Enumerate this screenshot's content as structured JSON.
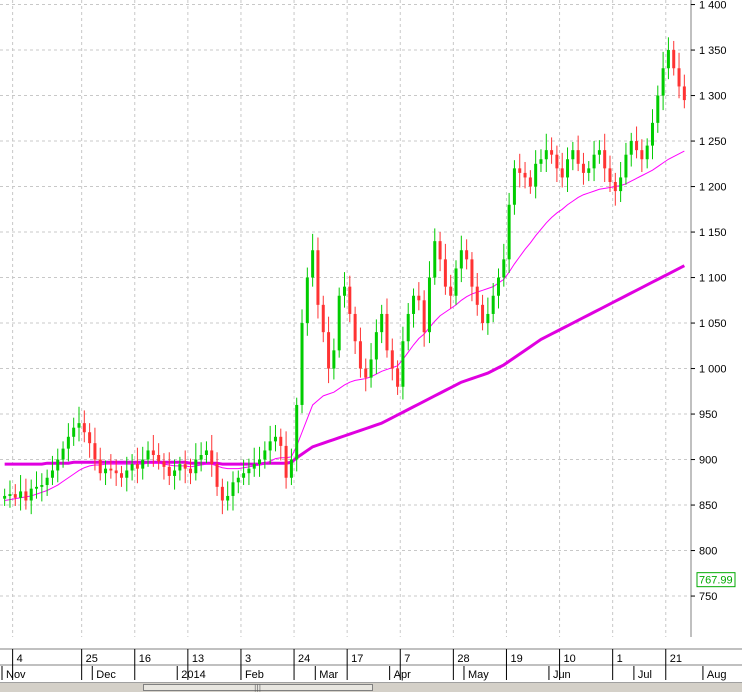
{
  "chart_data": {
    "type": "candlestick",
    "colors": {
      "up": "#00cc00",
      "down": "#ff3333",
      "ma_fast": "#ff00ff",
      "ma_slow": "#e000e0",
      "price_tag": "#00aa00"
    },
    "y_axis": {
      "ticks": [
        "1 400",
        "1 350",
        "1 300",
        "1 250",
        "1 200",
        "1 150",
        "1 100",
        "1 050",
        "1 000",
        "950",
        "900",
        "850",
        "800",
        "750"
      ],
      "tick_values": [
        1400,
        1350,
        1300,
        1250,
        1200,
        1150,
        1100,
        1050,
        1000,
        950,
        900,
        850,
        800,
        750
      ],
      "ylim": [
        705,
        1405
      ],
      "position": "right"
    },
    "x_axis": {
      "day_labels": [
        "4",
        "25",
        "16",
        "13",
        "3",
        "24",
        "17",
        "7",
        "28",
        "19",
        "10",
        "1",
        "21"
      ],
      "day_positions": [
        2,
        15,
        25,
        35,
        45,
        55,
        65,
        75,
        85,
        95,
        105,
        115,
        125
      ],
      "month_labels": [
        "Nov",
        "Dec",
        "2014",
        "Feb",
        "Mar",
        "Apr",
        "May",
        "Jun",
        "Jul",
        "Aug"
      ],
      "month_positions": [
        0,
        17,
        33,
        45,
        59,
        73,
        87,
        103,
        119,
        132
      ]
    },
    "last_price_tag": "767.99",
    "last_price_value": 767.99,
    "candles_close": [
      860,
      862,
      858,
      865,
      855,
      868,
      870,
      872,
      880,
      888,
      900,
      912,
      925,
      935,
      940,
      930,
      918,
      900,
      885,
      890,
      888,
      885,
      880,
      888,
      895,
      890,
      900,
      910,
      905,
      898,
      892,
      882,
      888,
      895,
      890,
      885,
      900,
      905,
      910,
      895,
      870,
      855,
      860,
      875,
      880,
      885,
      890,
      895,
      900,
      910,
      920,
      925,
      915,
      880,
      900,
      960,
      1050,
      1100,
      1130,
      1070,
      1040,
      1000,
      1020,
      1080,
      1090,
      1060,
      1030,
      1000,
      990,
      1010,
      1040,
      1060,
      1020,
      1000,
      980,
      1030,
      1060,
      1080,
      1075,
      1040,
      1100,
      1140,
      1120,
      1090,
      1080,
      1110,
      1130,
      1120,
      1090,
      1070,
      1050,
      1060,
      1080,
      1100,
      1120,
      1180,
      1220,
      1215,
      1210,
      1200,
      1225,
      1230,
      1240,
      1235,
      1220,
      1210,
      1230,
      1240,
      1225,
      1215,
      1220,
      1235,
      1240,
      1220,
      1205,
      1195,
      1210,
      1235,
      1250,
      1240,
      1230,
      1245,
      1270,
      1300,
      1330,
      1350,
      1330,
      1310,
      1295
    ],
    "ma_fast": [
      855,
      856,
      857,
      858,
      859,
      860,
      862,
      864,
      866,
      869,
      872,
      876,
      880,
      884,
      888,
      891,
      893,
      894,
      894,
      895,
      895,
      895,
      895,
      895,
      895,
      895,
      895,
      896,
      896,
      896,
      895,
      894,
      893,
      893,
      893,
      892,
      893,
      894,
      895,
      895,
      893,
      891,
      890,
      890,
      890,
      891,
      892,
      893,
      894,
      896,
      898,
      901,
      902,
      902,
      903,
      915,
      930,
      945,
      960,
      965,
      970,
      972,
      974,
      978,
      982,
      985,
      987,
      988,
      989,
      991,
      994,
      997,
      999,
      1001,
      1003,
      1010,
      1018,
      1026,
      1033,
      1038,
      1045,
      1052,
      1058,
      1062,
      1066,
      1070,
      1075,
      1079,
      1082,
      1084,
      1086,
      1088,
      1090,
      1094,
      1098,
      1106,
      1115,
      1123,
      1131,
      1138,
      1146,
      1153,
      1160,
      1166,
      1171,
      1175,
      1180,
      1184,
      1188,
      1191,
      1193,
      1195,
      1197,
      1198,
      1199,
      1200,
      1201,
      1203,
      1206,
      1209,
      1212,
      1215,
      1218,
      1222,
      1226,
      1230,
      1233,
      1236,
      1239
    ],
    "ma_slow": [
      895,
      895,
      895,
      895,
      895,
      895,
      895,
      895,
      896,
      896,
      896,
      896,
      896,
      897,
      897,
      897,
      897,
      897,
      897,
      897,
      897,
      897,
      897,
      897,
      897,
      897,
      897,
      897,
      897,
      897,
      897,
      897,
      897,
      897,
      897,
      896,
      896,
      896,
      896,
      896,
      896,
      895,
      895,
      895,
      895,
      895,
      895,
      895,
      895,
      896,
      896,
      896,
      896,
      896,
      897,
      902,
      906,
      910,
      914,
      916,
      918,
      920,
      922,
      924,
      926,
      928,
      930,
      932,
      934,
      936,
      938,
      940,
      943,
      946,
      949,
      952,
      955,
      958,
      961,
      964,
      967,
      970,
      973,
      976,
      979,
      982,
      985,
      987,
      989,
      991,
      993,
      995,
      998,
      1001,
      1004,
      1008,
      1012,
      1016,
      1020,
      1024,
      1028,
      1032,
      1035,
      1038,
      1041,
      1044,
      1047,
      1050,
      1053,
      1056,
      1059,
      1062,
      1065,
      1068,
      1071,
      1074,
      1077,
      1080,
      1083,
      1086,
      1089,
      1092,
      1095,
      1098,
      1101,
      1104,
      1107,
      1110,
      1113
    ]
  }
}
